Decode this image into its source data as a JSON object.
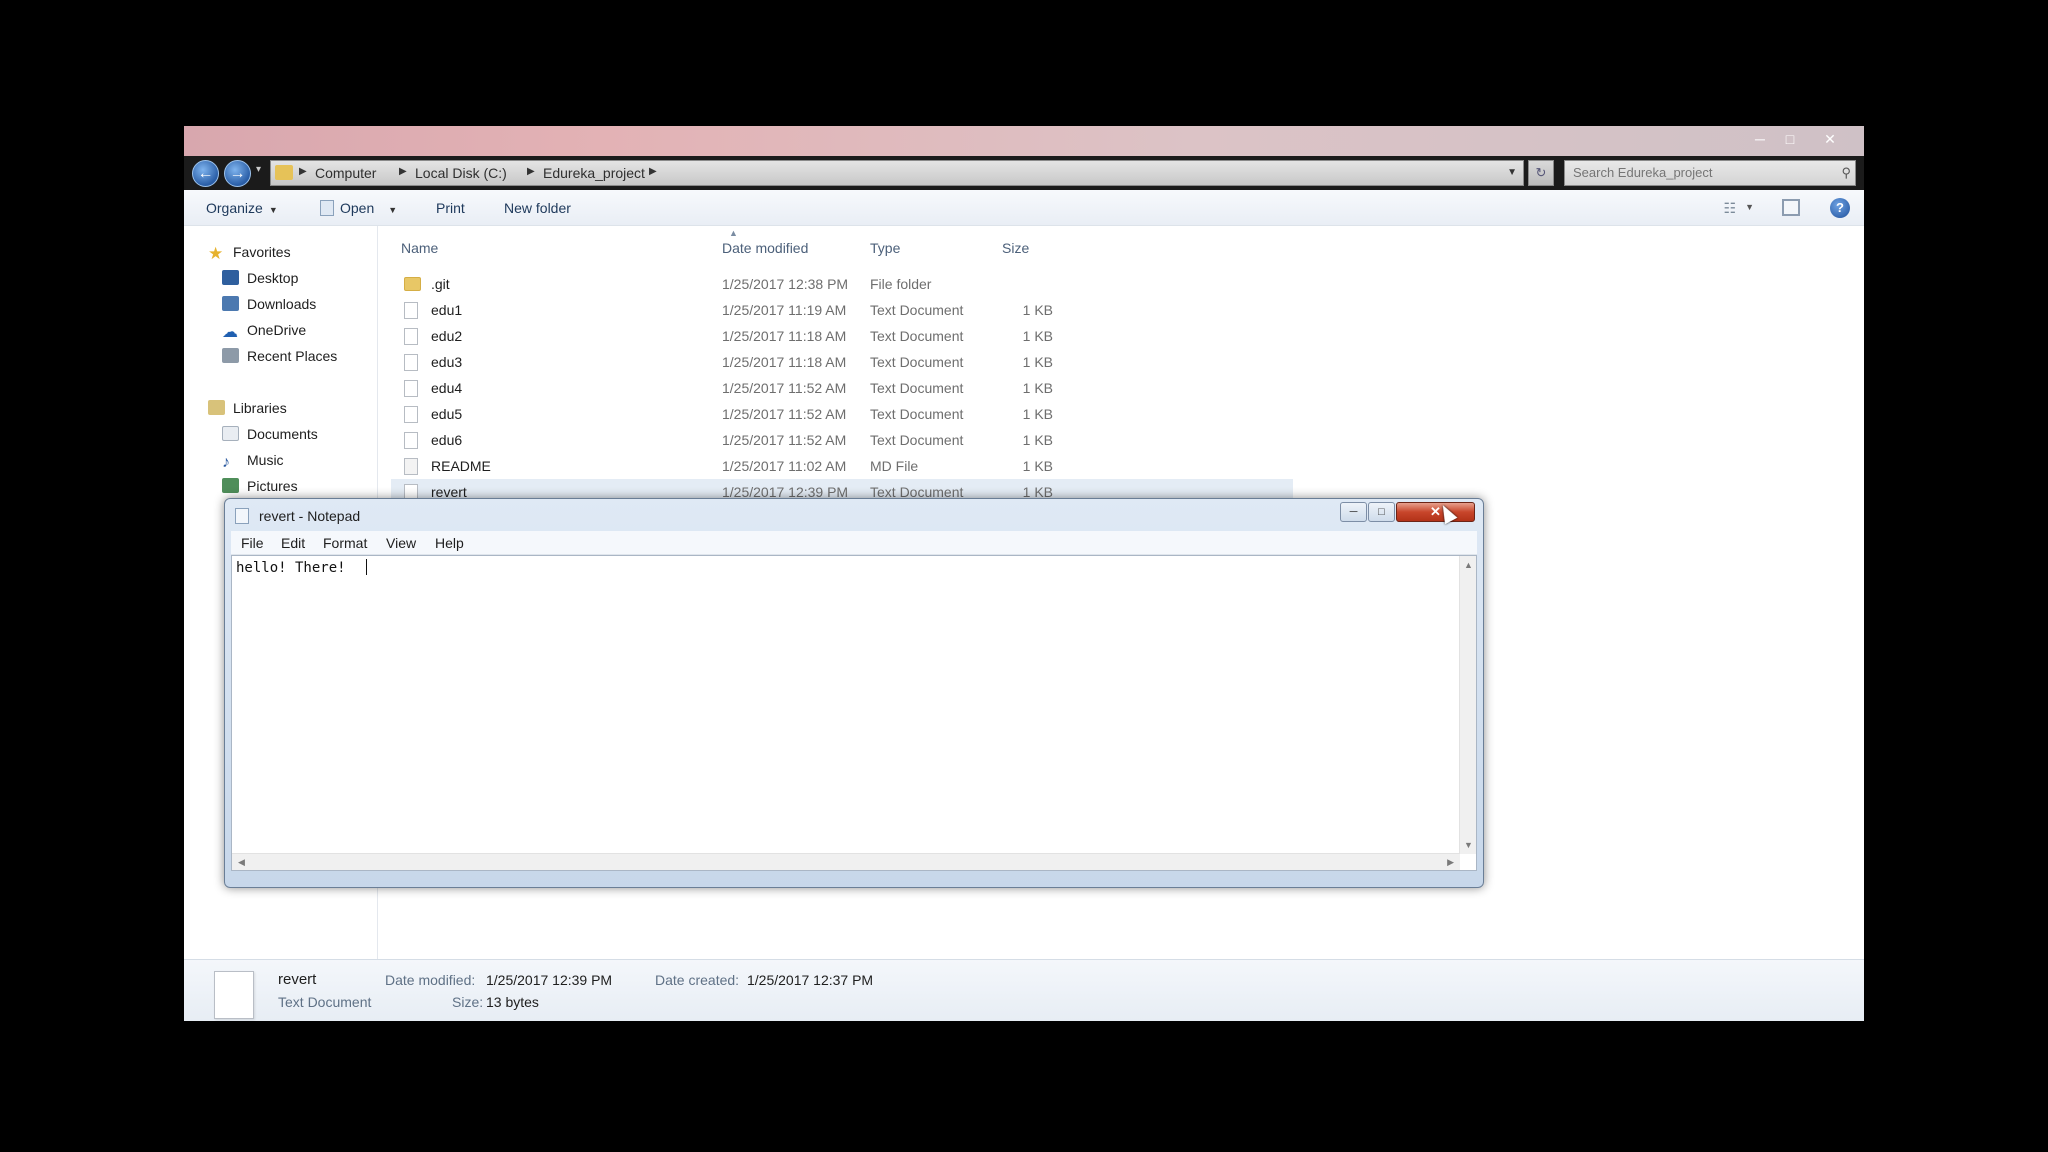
{
  "explorer": {
    "window_controls": {
      "minimize": "─",
      "maximize": "□",
      "close": "✕"
    },
    "nav": {
      "back": "←",
      "forward": "→",
      "recent": "▾"
    },
    "breadcrumb": [
      "Computer",
      "Local Disk (C:)",
      "Edureka_project"
    ],
    "search_placeholder": "Search Edureka_project",
    "toolbar": {
      "organize": "Organize",
      "open": "Open",
      "print": "Print",
      "new_folder": "New folder"
    },
    "nav_pane": {
      "favorites": "Favorites",
      "favorite_items": [
        "Desktop",
        "Downloads",
        "OneDrive",
        "Recent Places"
      ],
      "libraries": "Libraries",
      "library_items": [
        "Documents",
        "Music",
        "Pictures"
      ]
    },
    "columns": {
      "name": "Name",
      "date": "Date modified",
      "type": "Type",
      "size": "Size"
    },
    "files": [
      {
        "name": ".git",
        "date": "1/25/2017 12:38 PM",
        "type": "File folder",
        "size": "",
        "icon": "folder-icon"
      },
      {
        "name": "edu1",
        "date": "1/25/2017 11:19 AM",
        "type": "Text Document",
        "size": "1 KB",
        "icon": "text-file-icon"
      },
      {
        "name": "edu2",
        "date": "1/25/2017 11:18 AM",
        "type": "Text Document",
        "size": "1 KB",
        "icon": "text-file-icon"
      },
      {
        "name": "edu3",
        "date": "1/25/2017 11:18 AM",
        "type": "Text Document",
        "size": "1 KB",
        "icon": "text-file-icon"
      },
      {
        "name": "edu4",
        "date": "1/25/2017 11:52 AM",
        "type": "Text Document",
        "size": "1 KB",
        "icon": "text-file-icon"
      },
      {
        "name": "edu5",
        "date": "1/25/2017 11:52 AM",
        "type": "Text Document",
        "size": "1 KB",
        "icon": "text-file-icon"
      },
      {
        "name": "edu6",
        "date": "1/25/2017 11:52 AM",
        "type": "Text Document",
        "size": "1 KB",
        "icon": "text-file-icon"
      },
      {
        "name": "README",
        "date": "1/25/2017 11:02 AM",
        "type": "MD File",
        "size": "1 KB",
        "icon": "md-file-icon"
      },
      {
        "name": "revert",
        "date": "1/25/2017 12:39 PM",
        "type": "Text Document",
        "size": "1 KB",
        "icon": "text-file-icon"
      }
    ],
    "details": {
      "name": "revert",
      "type": "Text Document",
      "date_modified_label": "Date modified:",
      "date_modified": "1/25/2017 12:39 PM",
      "date_created_label": "Date created:",
      "date_created": "1/25/2017 12:37 PM",
      "size_label": "Size:",
      "size": "13 bytes"
    }
  },
  "notepad": {
    "title": "revert - Notepad",
    "controls": {
      "minimize": "─",
      "maximize": "□",
      "close": "✕"
    },
    "menu": [
      "File",
      "Edit",
      "Format",
      "View",
      "Help"
    ],
    "content": "hello! There!"
  }
}
